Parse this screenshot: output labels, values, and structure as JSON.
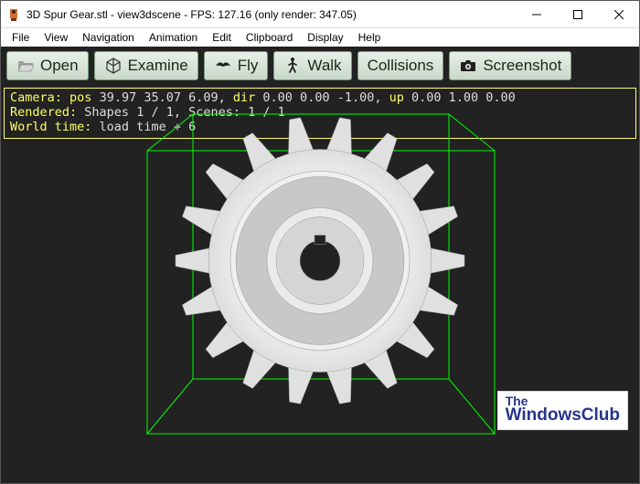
{
  "title": "3D Spur Gear.stl - view3dscene - FPS: 127.16 (only render: 347.05)",
  "menu": [
    "File",
    "View",
    "Navigation",
    "Animation",
    "Edit",
    "Clipboard",
    "Display",
    "Help"
  ],
  "toolbar": {
    "open": "Open",
    "examine": "Examine",
    "fly": "Fly",
    "walk": "Walk",
    "collisions": "Collisions",
    "screenshot": "Screenshot"
  },
  "status": {
    "camera_label": "Camera:",
    "pos_label": "pos",
    "pos_val": "39.97 35.07 6.09,",
    "dir_label": "dir",
    "dir_val": "0.00 0.00 -1.00,",
    "up_label": "up",
    "up_val": "0.00 1.00 0.00",
    "rendered_label": "Rendered:",
    "rendered_val": "Shapes 1 / 1, Scenes: 1 / 1",
    "worldtime_label": "World time:",
    "worldtime_val": "load time + 6"
  },
  "watermark": {
    "the": "The",
    "wc": "WindowsClub"
  }
}
